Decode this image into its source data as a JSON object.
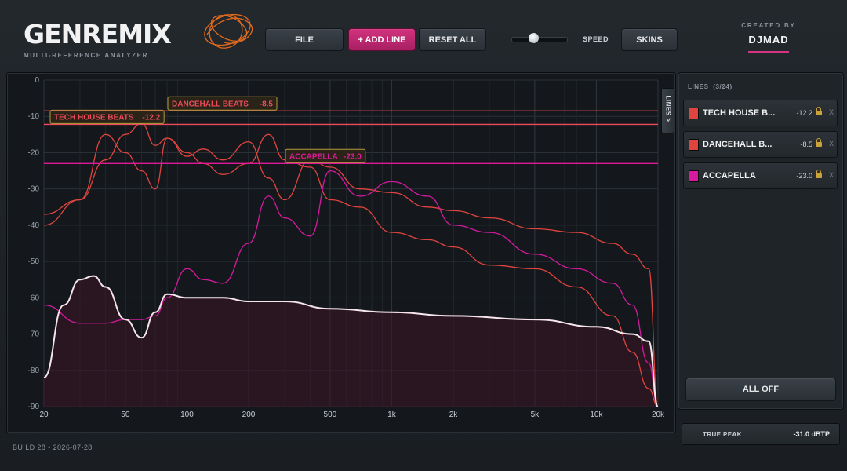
{
  "header": {
    "logo_text": "GENREMIX",
    "subtitle": "MULTI-REFERENCE ANALYZER",
    "buttons": {
      "file": "FILE",
      "add_line": "+ ADD LINE",
      "reset_all": "RESET ALL",
      "skins": "SKINS"
    },
    "speed_label": "SPEED",
    "speed_value": 0.35,
    "created_by_label": "CREATED BY",
    "author": "DJMAD"
  },
  "analyzer": {
    "lines_tab_label": "LINES >",
    "y_ticks": [
      "0",
      "-10",
      "-20",
      "-30",
      "-40",
      "-50",
      "-60",
      "-70",
      "-80",
      "-90"
    ],
    "x_ticks": [
      "20",
      "50",
      "100",
      "200",
      "500",
      "1k",
      "2k",
      "5k",
      "10k",
      "20k"
    ],
    "markers": [
      {
        "name": "TECH HOUSE BEATS",
        "value": "-12.2",
        "color": "#ef4a5a"
      },
      {
        "name": "DANCEHALL BEATS",
        "value": "-8.5",
        "color": "#ef4a5a"
      },
      {
        "name": "ACCAPELLA",
        "value": "-23.0",
        "color": "#e0189a"
      }
    ]
  },
  "chart_data": {
    "type": "line",
    "xscale": "log",
    "xlabel": "",
    "ylabel": "",
    "xlim": [
      20,
      20000
    ],
    "ylim": [
      -90,
      0
    ],
    "grid": true,
    "series": [
      {
        "name": "TECH HOUSE BEATS",
        "color": "#e0443f",
        "x": [
          20,
          30,
          40,
          50,
          60,
          70,
          80,
          100,
          120,
          150,
          200,
          250,
          300,
          400,
          500,
          700,
          1000,
          1500,
          2000,
          3000,
          5000,
          8000,
          12000,
          15000,
          18000,
          20000
        ],
        "y": [
          -40,
          -33,
          -22,
          -15,
          -12,
          -18,
          -16,
          -20,
          -23,
          -26,
          -23,
          -15,
          -22,
          -24,
          -33,
          -35,
          -42,
          -44,
          -46,
          -51,
          -52,
          -57,
          -65,
          -75,
          -85,
          -90
        ]
      },
      {
        "name": "DANCEHALL BEATS",
        "color": "#e0443f",
        "x": [
          20,
          30,
          40,
          50,
          60,
          70,
          80,
          100,
          120,
          150,
          200,
          250,
          300,
          400,
          500,
          700,
          1000,
          1500,
          2000,
          3000,
          5000,
          8000,
          12000,
          15000,
          18000,
          20000
        ],
        "y": [
          -37,
          -33,
          -15,
          -20,
          -25,
          -30,
          -16,
          -21,
          -19,
          -22,
          -17,
          -27,
          -33,
          -22,
          -24,
          -30,
          -31,
          -35,
          -36,
          -38,
          -41,
          -42,
          -45,
          -48,
          -52,
          -90
        ]
      },
      {
        "name": "ACCAPELLA",
        "color": "#d51aa0",
        "x": [
          20,
          30,
          40,
          50,
          60,
          70,
          80,
          100,
          120,
          150,
          200,
          250,
          300,
          400,
          500,
          700,
          1000,
          1500,
          2000,
          3000,
          5000,
          8000,
          12000,
          15000,
          18000,
          20000
        ],
        "y": [
          -62,
          -67,
          -67,
          -66,
          -66,
          -65,
          -60,
          -52,
          -55,
          -56,
          -45,
          -32,
          -38,
          -43,
          -25,
          -32,
          -28,
          -32,
          -40,
          -42,
          -48,
          -52,
          -56,
          -62,
          -78,
          -90
        ]
      },
      {
        "name": "",
        "color": "#f6e6ec",
        "x": [
          20,
          25,
          30,
          35,
          40,
          50,
          60,
          70,
          80,
          100,
          120,
          150,
          200,
          300,
          500,
          1000,
          2000,
          5000,
          10000,
          15000,
          18000,
          20000
        ],
        "y": [
          -82,
          -62,
          -55,
          -54,
          -57,
          -66,
          -71,
          -64,
          -59,
          -60,
          -60,
          -60,
          -61,
          -61,
          -63,
          -64,
          -65,
          -66,
          -68,
          -70,
          -72,
          -90
        ]
      }
    ]
  },
  "panel": {
    "title": "LINES",
    "count": "(3/24)",
    "items": [
      {
        "label": "TECH HOUSE B...",
        "value": "-12.2",
        "color": "#e0443f"
      },
      {
        "label": "DANCEHALL B...",
        "value": "-8.5",
        "color": "#e0443f"
      },
      {
        "label": "ACCAPELLA",
        "value": "-23.0",
        "color": "#d51aa0"
      }
    ],
    "close_glyph": "X",
    "all_off": "ALL OFF"
  },
  "true_peak": {
    "label": "TRUE PEAK",
    "value": "-31.0 dBTP"
  },
  "footer": {
    "build": "BUILD 28",
    "sep": "•",
    "date": "2026-07-28"
  }
}
